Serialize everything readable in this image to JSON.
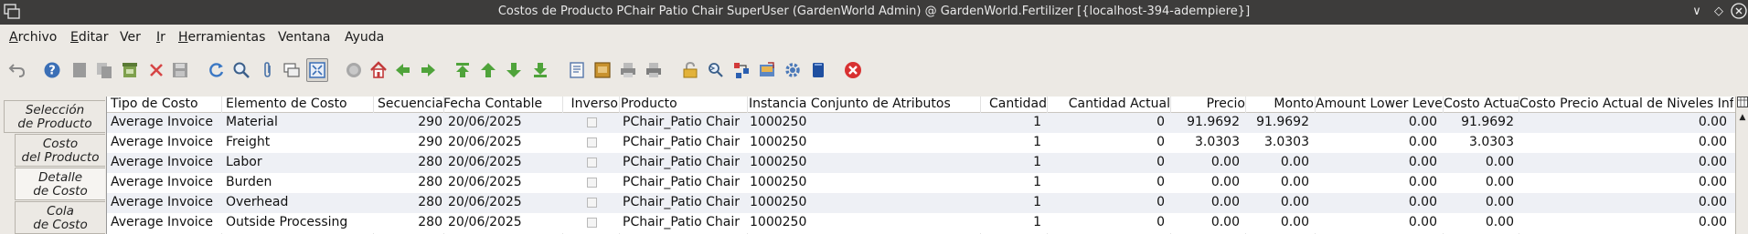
{
  "window": {
    "title": "Costos de Producto PChair Patio Chair SuperUser (GardenWorld Admin) @ GardenWorld.Fertilizer [{localhost-394-adempiere}]"
  },
  "menu": [
    {
      "label": "Archivo",
      "u": "A",
      "rest": "rchivo"
    },
    {
      "label": "Editar",
      "u": "E",
      "rest": "ditar"
    },
    {
      "label": "Ver",
      "u": "",
      "rest": "Ver"
    },
    {
      "label": "Ir",
      "u": "I",
      "rest": "r"
    },
    {
      "label": "Herramientas",
      "u": "H",
      "rest": "erramientas"
    },
    {
      "label": "Ventana",
      "u": "",
      "rest": "Ventana"
    },
    {
      "label": "Ayuda",
      "u": "",
      "rest": "Ayuda"
    }
  ],
  "toolbar_icons": [
    "undo-icon",
    "help-icon",
    "new-icon",
    "copy-icon",
    "delete-selection-icon",
    "delete-icon",
    "save-icon",
    "refresh-icon",
    "find-icon",
    "attachment-icon",
    "chat-icon",
    "grid-toggle-icon",
    "history-icon",
    "home-icon",
    "parent-record-icon",
    "detail-record-icon",
    "first-record-icon",
    "previous-record-icon",
    "next-record-icon",
    "last-record-icon",
    "report-icon",
    "archive-icon",
    "print-preview-icon",
    "print-icon",
    "lock-icon",
    "zoom-across-icon",
    "workflow-icon",
    "product-info-icon",
    "process-icon",
    "window-icon",
    "exit-icon"
  ],
  "tabs": [
    {
      "line1": "Selección",
      "line2": "de Producto",
      "selected": false
    },
    {
      "line1": "Costo",
      "line2": "del Producto",
      "selected": false
    },
    {
      "line1": "Detalle",
      "line2": "de Costo",
      "selected": true
    },
    {
      "line1": "Cola",
      "line2": "de Costo",
      "selected": false
    }
  ],
  "grid": {
    "columns": [
      "Tipo de Costo",
      "Elemento de Costo",
      "Secuencia",
      "Fecha Contable",
      "Inverso",
      "Producto",
      "Instancia Conjunto de Atributos",
      "Cantidad",
      "Cantidad Actual",
      "Precio",
      "Monto",
      "Amount Lower Level",
      "Costo Actual",
      "Costo Precio Actual de Niveles Infe..."
    ],
    "rows": [
      {
        "tipo": "Average Invoice",
        "elemento": "Material",
        "secuencia": "290",
        "fecha": "20/06/2025",
        "producto": "PChair_Patio Chair",
        "instancia": "1000250",
        "cantidad": "1",
        "cantidad_actual": "0",
        "precio": "91.9692",
        "monto": "91.9692",
        "amount_lower": "0.00",
        "costo_actual": "91.9692",
        "costo_niveles": "0.00"
      },
      {
        "tipo": "Average Invoice",
        "elemento": "Freight",
        "secuencia": "290",
        "fecha": "20/06/2025",
        "producto": "PChair_Patio Chair",
        "instancia": "1000250",
        "cantidad": "1",
        "cantidad_actual": "0",
        "precio": "3.0303",
        "monto": "3.0303",
        "amount_lower": "0.00",
        "costo_actual": "3.0303",
        "costo_niveles": "0.00"
      },
      {
        "tipo": "Average Invoice",
        "elemento": "Labor",
        "secuencia": "280",
        "fecha": "20/06/2025",
        "producto": "PChair_Patio Chair",
        "instancia": "1000250",
        "cantidad": "1",
        "cantidad_actual": "0",
        "precio": "0.00",
        "monto": "0.00",
        "amount_lower": "0.00",
        "costo_actual": "0.00",
        "costo_niveles": "0.00"
      },
      {
        "tipo": "Average Invoice",
        "elemento": "Burden",
        "secuencia": "280",
        "fecha": "20/06/2025",
        "producto": "PChair_Patio Chair",
        "instancia": "1000250",
        "cantidad": "1",
        "cantidad_actual": "0",
        "precio": "0.00",
        "monto": "0.00",
        "amount_lower": "0.00",
        "costo_actual": "0.00",
        "costo_niveles": "0.00"
      },
      {
        "tipo": "Average Invoice",
        "elemento": "Overhead",
        "secuencia": "280",
        "fecha": "20/06/2025",
        "producto": "PChair_Patio Chair",
        "instancia": "1000250",
        "cantidad": "1",
        "cantidad_actual": "0",
        "precio": "0.00",
        "monto": "0.00",
        "amount_lower": "0.00",
        "costo_actual": "0.00",
        "costo_niveles": "0.00"
      },
      {
        "tipo": "Average Invoice",
        "elemento": "Outside Processing",
        "secuencia": "280",
        "fecha": "20/06/2025",
        "producto": "PChair_Patio Chair",
        "instancia": "1000250",
        "cantidad": "1",
        "cantidad_actual": "0",
        "precio": "0.00",
        "monto": "0.00",
        "amount_lower": "0.00",
        "costo_actual": "0.00",
        "costo_niveles": "0.00"
      }
    ]
  }
}
